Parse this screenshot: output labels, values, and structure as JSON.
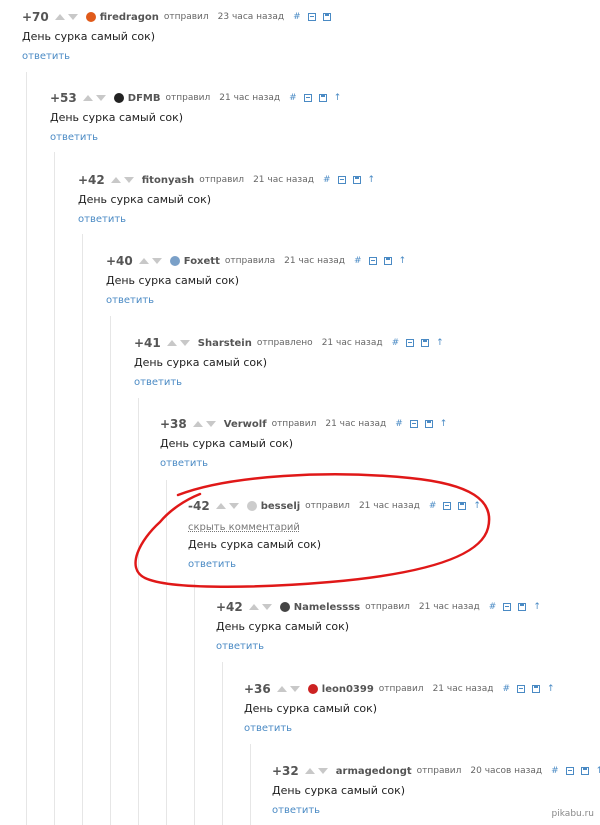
{
  "comments": [
    {
      "rating": "+70",
      "author": "firedragon",
      "avatar": "#e05a1a",
      "action": "отправил",
      "time": "23 часа назад",
      "text": "День сурка самый сок)",
      "reply": "ответить",
      "hash": "#",
      "up": ""
    },
    {
      "rating": "+53",
      "author": "DFMB",
      "avatar": "#222222",
      "action": "отправил",
      "time": "21 час назад",
      "text": "День сурка самый сок)",
      "reply": "ответить",
      "hash": "#",
      "up": "↑"
    },
    {
      "rating": "+42",
      "author": "fitonyash",
      "avatar": "",
      "action": "отправил",
      "time": "21 час назад",
      "text": "День сурка самый сок)",
      "reply": "ответить",
      "hash": "#",
      "up": "↑"
    },
    {
      "rating": "+40",
      "author": "Foxett",
      "avatar": "#7aa0c8",
      "action": "отправила",
      "time": "21 час назад",
      "text": "День сурка самый сок)",
      "reply": "ответить",
      "hash": "#",
      "up": "↑"
    },
    {
      "rating": "+41",
      "author": "Sharstein",
      "avatar": "",
      "action": "отправлено",
      "time": "21 час назад",
      "text": "День сурка самый сок)",
      "reply": "ответить",
      "hash": "#",
      "up": "↑"
    },
    {
      "rating": "+38",
      "author": "Verwolf",
      "avatar": "",
      "action": "отправил",
      "time": "21 час назад",
      "text": "День сурка самый сок)",
      "reply": "ответить",
      "hash": "#",
      "up": "↑"
    },
    {
      "rating": "-42",
      "author": "besselj",
      "avatar": "#cccccc",
      "action": "отправил",
      "time": "21 час назад",
      "text": "День сурка самый сок)",
      "reply": "ответить",
      "hash": "#",
      "up": "↑",
      "hide": "скрыть комментарий"
    },
    {
      "rating": "+42",
      "author": "Namelessss",
      "avatar": "#444444",
      "action": "отправил",
      "time": "21 час назад",
      "text": "День сурка самый сок)",
      "reply": "ответить",
      "hash": "#",
      "up": "↑"
    },
    {
      "rating": "+36",
      "author": "leon0399",
      "avatar": "#cc2222",
      "action": "отправил",
      "time": "21 час назад",
      "text": "День сурка самый сок)",
      "reply": "ответить",
      "hash": "#",
      "up": "↑"
    },
    {
      "rating": "+32",
      "author": "armagedongt",
      "avatar": "",
      "action": "отправил",
      "time": "20 часов назад",
      "text": "День сурка самый сок)",
      "reply": "ответить",
      "hash": "#",
      "up": "↑"
    }
  ],
  "watermark": "pikabu.ru",
  "colors": {
    "link": "#4a8ac4",
    "annotation": "#e01818",
    "thread_line": "#e6e6e6"
  }
}
